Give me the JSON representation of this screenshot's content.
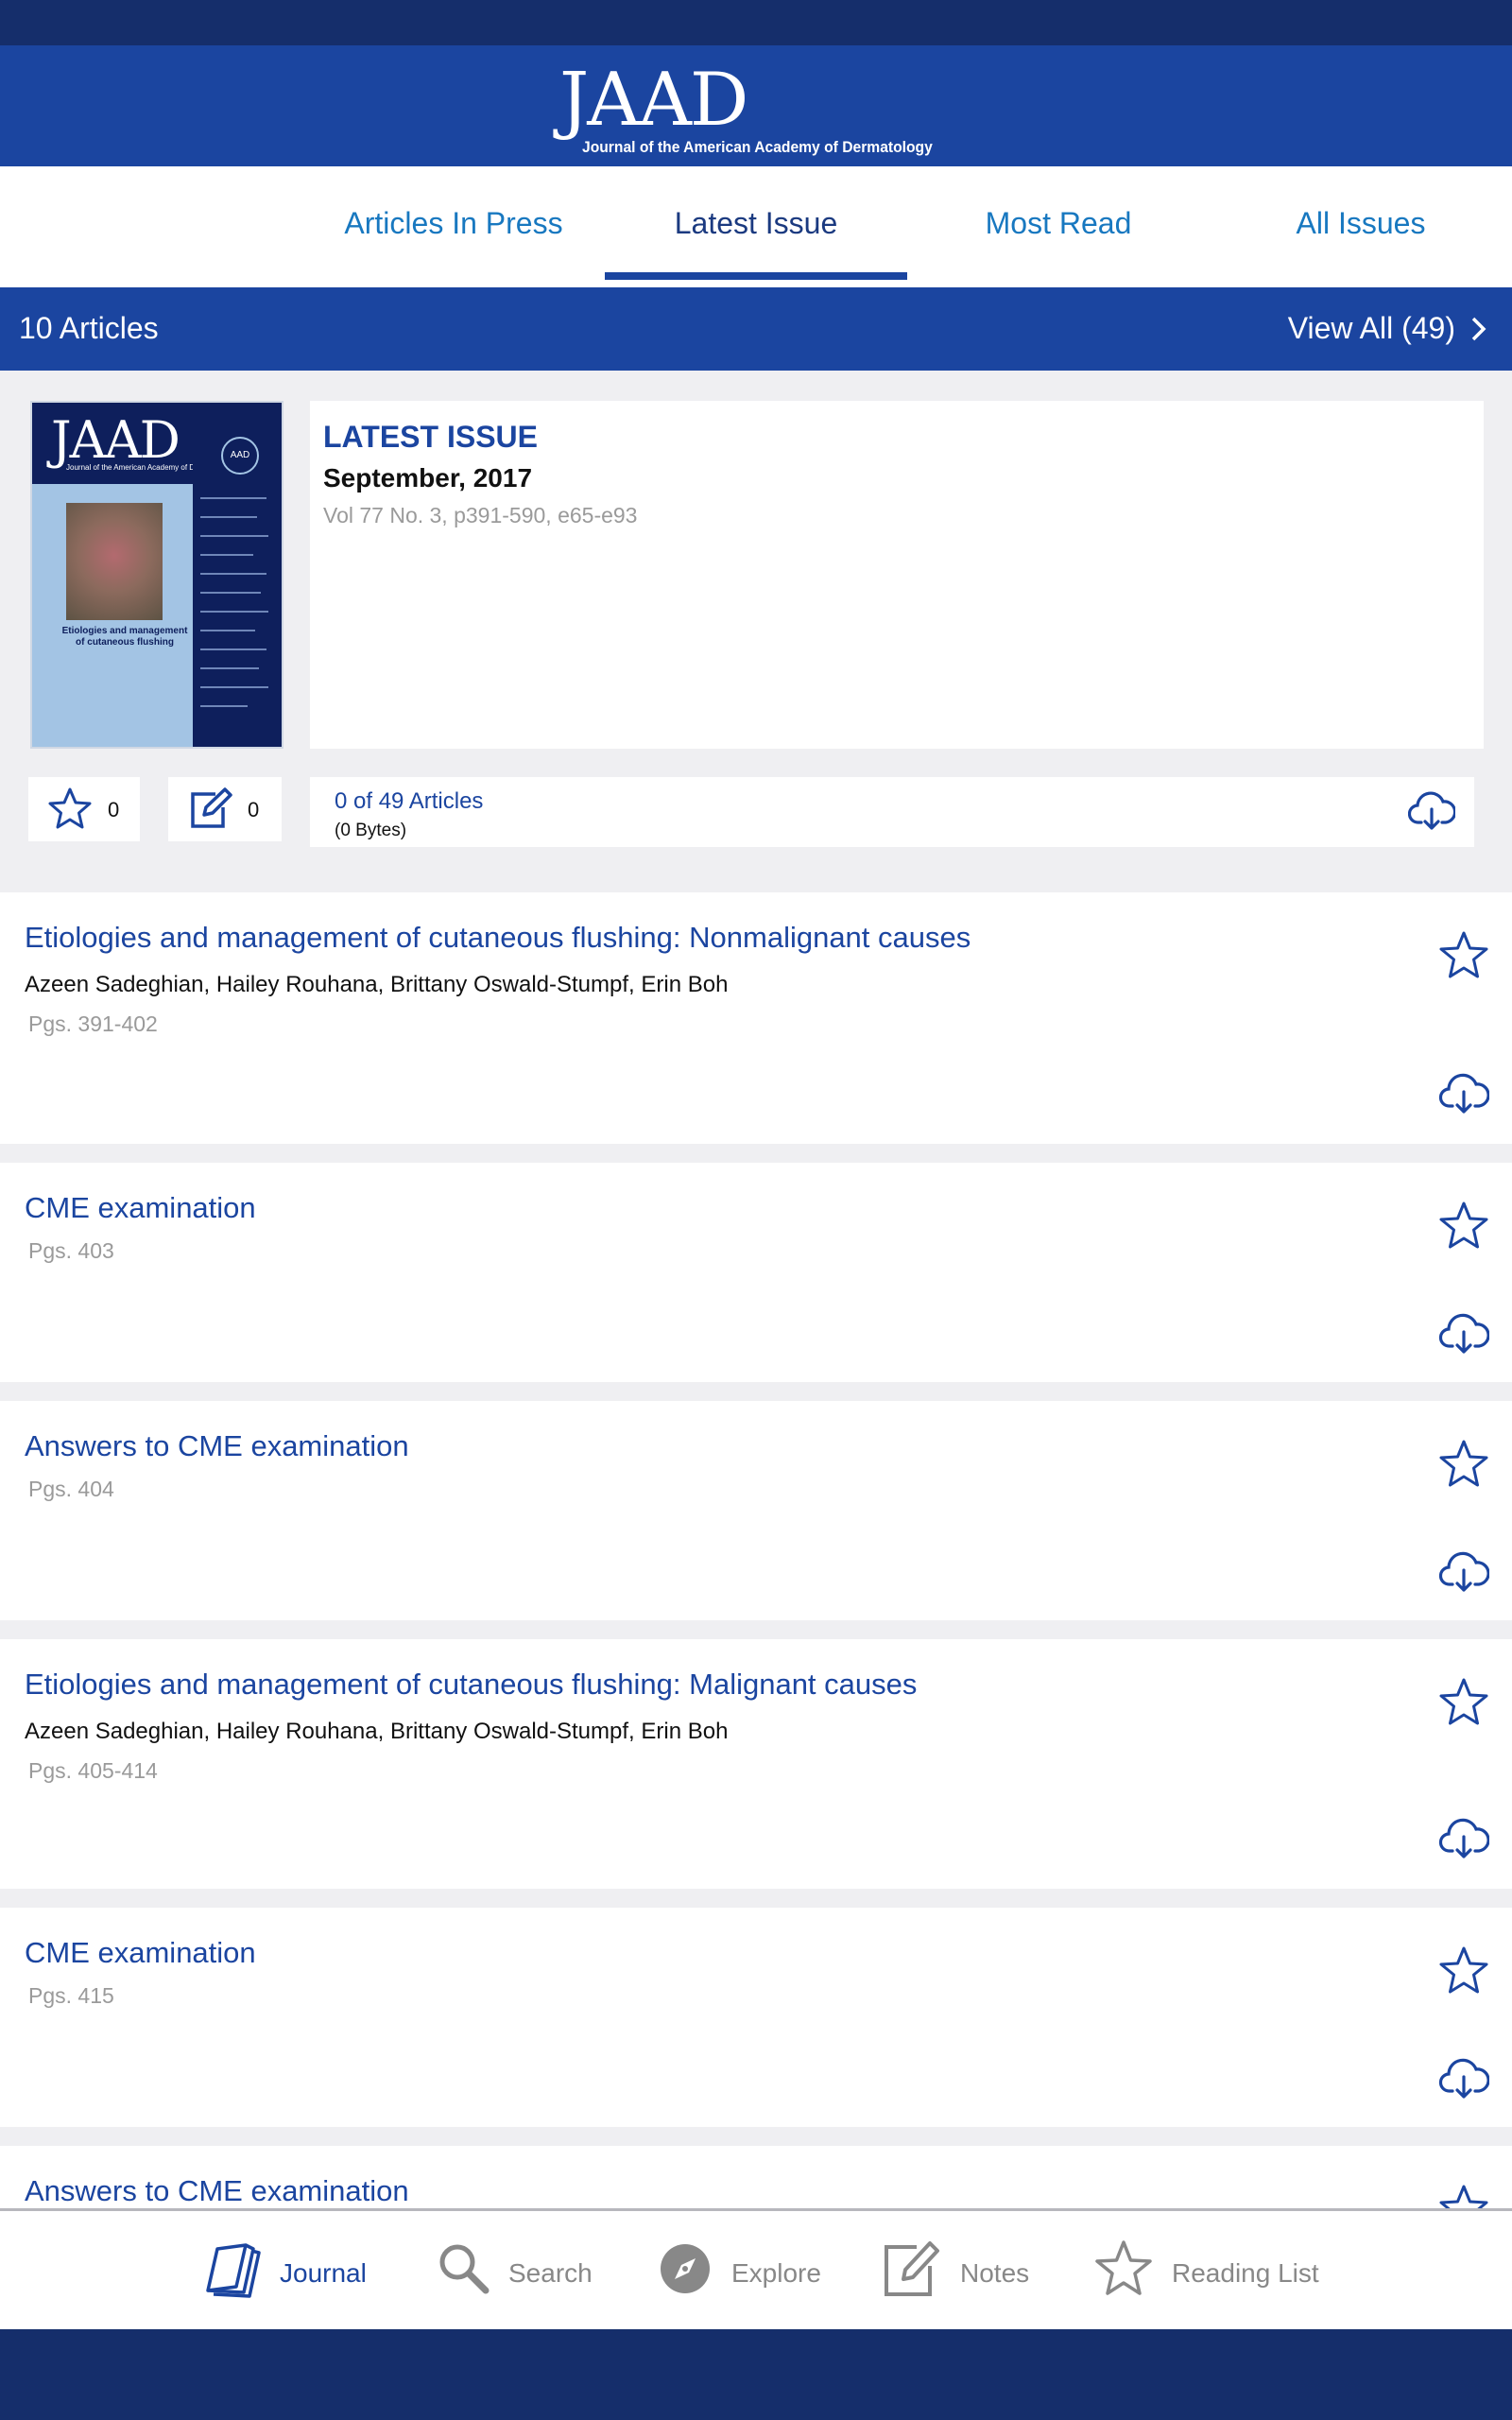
{
  "header": {
    "logo_mark": "JAAD",
    "logo_subtitle": "Journal of the American Academy of Dermatology"
  },
  "tabs": [
    {
      "label": "Articles In Press"
    },
    {
      "label": "Latest Issue",
      "active": true
    },
    {
      "label": "Most Read"
    },
    {
      "label": "All Issues"
    }
  ],
  "subheader": {
    "count": "10 Articles",
    "view_all": "View All (49)"
  },
  "issue": {
    "label": "LATEST ISSUE",
    "date": "September, 2017",
    "volume": "Vol 77 No. 3, p391-590, e65-e93",
    "cover": {
      "mark": "JAAD",
      "subtitle": "Journal of the American Academy of Dermatology",
      "seal": "AAD",
      "title": "Etiologies and management of cutaneous flushing"
    },
    "favorites_count": "0",
    "notes_count": "0",
    "downloaded": "0 of 49 Articles",
    "bytes": "(0 Bytes)"
  },
  "articles": [
    {
      "title": "Etiologies and management of cutaneous flushing: Nonmalignant causes",
      "authors": "Azeen Sadeghian, Hailey Rouhana, Brittany Oswald-Stumpf, Erin Boh",
      "pages": "Pgs. 391-402"
    },
    {
      "title": "CME examination",
      "authors": "",
      "pages": "Pgs. 403"
    },
    {
      "title": "Answers to CME examination",
      "authors": "",
      "pages": "Pgs. 404"
    },
    {
      "title": "Etiologies and management of cutaneous flushing: Malignant causes",
      "authors": "Azeen Sadeghian, Hailey Rouhana, Brittany Oswald-Stumpf, Erin Boh",
      "pages": "Pgs. 405-414"
    },
    {
      "title": "CME examination",
      "authors": "",
      "pages": "Pgs. 415"
    },
    {
      "title": "Answers to CME examination",
      "authors": "",
      "pages": ""
    }
  ],
  "bottom_nav": [
    {
      "label": "Journal",
      "icon": "journal-icon",
      "active": true
    },
    {
      "label": "Search",
      "icon": "search-icon"
    },
    {
      "label": "Explore",
      "icon": "compass-icon"
    },
    {
      "label": "Notes",
      "icon": "notes-icon"
    },
    {
      "label": "Reading List",
      "icon": "star-icon"
    }
  ],
  "colors": {
    "brand_blue": "#1b45a0",
    "dark_navy": "#152e6b",
    "tab_blue": "#1878c0",
    "muted_gray": "#9a9a9a"
  }
}
